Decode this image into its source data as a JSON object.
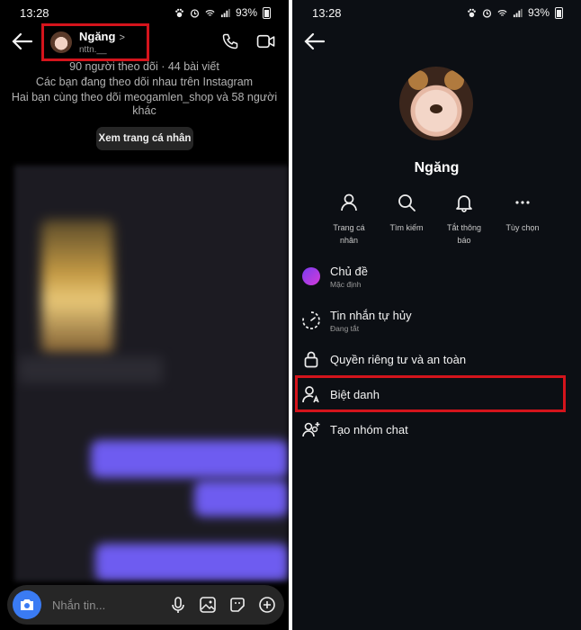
{
  "left": {
    "status": {
      "time": "13:28",
      "battery": "93%"
    },
    "header": {
      "name": "Ngăng",
      "chevron": ">",
      "handle": "nttn.__"
    },
    "info": {
      "stats": "90 người theo dõi · 44 bài viết",
      "mutual": "Các bạn đang theo dõi nhau trên Instagram",
      "common_line1": "Hai bạn cùng theo dõi meogamlen_shop và 58 người",
      "common_line2": "khác"
    },
    "view_profile_label": "Xem trang cá nhân",
    "composer": {
      "placeholder": "Nhắn tin..."
    }
  },
  "right": {
    "status": {
      "time": "13:28",
      "battery": "93%"
    },
    "profile_name": "Ngăng",
    "actions": [
      {
        "label_line1": "Trang cá",
        "label_line2": "nhân",
        "icon": "person-icon"
      },
      {
        "label_line1": "Tìm kiếm",
        "label_line2": "",
        "icon": "search-icon"
      },
      {
        "label_line1": "Tắt thông",
        "label_line2": "báo",
        "icon": "bell-icon"
      },
      {
        "label_line1": "Tùy chọn",
        "label_line2": "",
        "icon": "more-icon"
      }
    ],
    "menu": [
      {
        "title": "Chủ đề",
        "subtitle": "Mặc định",
        "icon": "theme-circle-icon"
      },
      {
        "title": "Tin nhắn tự hủy",
        "subtitle": "Đang tắt",
        "icon": "timer-icon"
      },
      {
        "title": "Quyền riêng tư và an toàn",
        "subtitle": "",
        "icon": "lock-icon"
      },
      {
        "title": "Biệt danh",
        "subtitle": "",
        "icon": "nickname-icon"
      },
      {
        "title": "Tạo nhóm chat",
        "subtitle": "",
        "icon": "group-add-icon"
      }
    ],
    "colors": {
      "highlight": "#d4141c",
      "theme_gradient_start": "#7a3cf0",
      "theme_gradient_end": "#d43bd8"
    }
  }
}
